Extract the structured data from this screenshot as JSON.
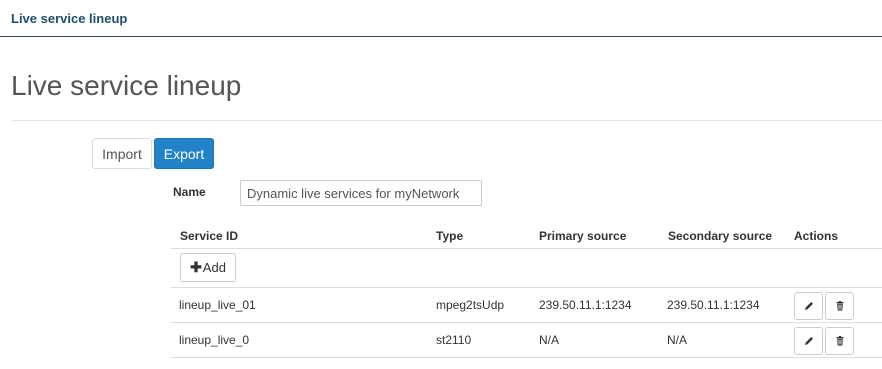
{
  "header": {
    "brand": "Live service lineup"
  },
  "page": {
    "title": "Live service lineup"
  },
  "toolbar": {
    "import_label": "Import",
    "export_label": "Export"
  },
  "form": {
    "name_label": "Name",
    "name_value": "Dynamic live services for myNetwork"
  },
  "table": {
    "columns": [
      "Service ID",
      "Type",
      "Primary source",
      "Secondary source",
      "Actions"
    ],
    "add_label": "Add",
    "rows": [
      {
        "service_id": "lineup_live_01",
        "type": "mpeg2tsUdp",
        "primary": "239.50.11.1:1234",
        "secondary": "239.50.11.1:1234"
      },
      {
        "service_id": "lineup_live_0",
        "type": "st2110",
        "primary": "N/A",
        "secondary": "N/A"
      }
    ]
  },
  "icons": {
    "edit": "pencil-icon",
    "delete": "trash-icon",
    "add": "plus-icon"
  },
  "colors": {
    "accent": "#2182c8",
    "header_text": "#1f4e6b"
  }
}
